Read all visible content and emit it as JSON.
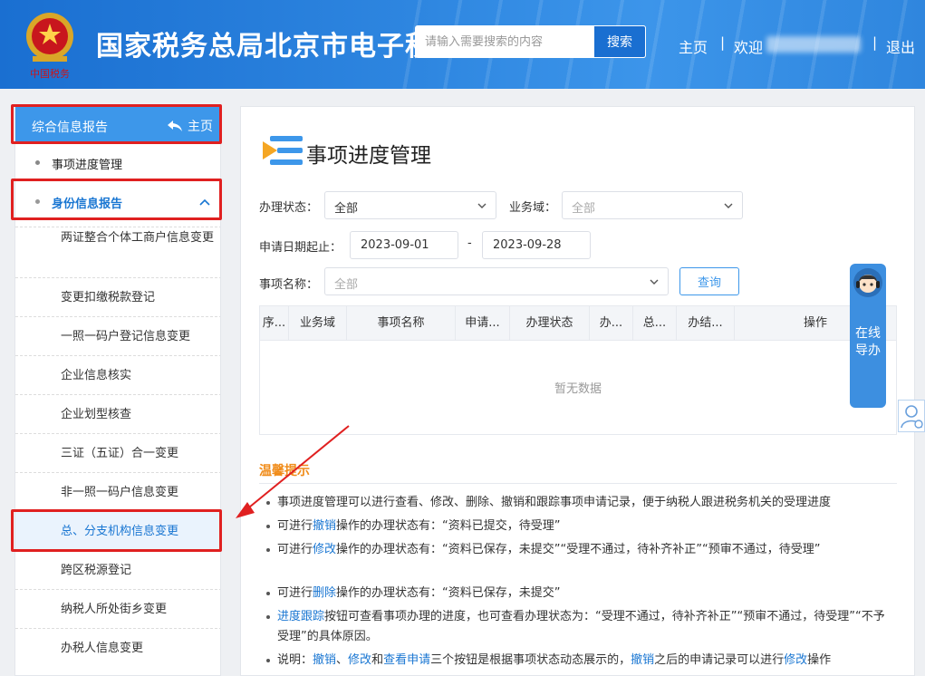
{
  "header": {
    "title": "国家税务总局北京市电子税",
    "emblem_text": "中国税务",
    "search_placeholder": "请输入需要搜索的内容",
    "search_button": "搜索",
    "nav_home": "主页",
    "nav_sep": "|",
    "nav_welcome": "欢迎",
    "nav_exit": "退出"
  },
  "sidebar": {
    "head_title": "综合信息报告",
    "head_home": "主页",
    "item_progress": "事项进度管理",
    "group_label": "身份信息报告",
    "sub_items": [
      "两证整合个体工商户信息变更",
      "变更扣缴税款登记",
      "一照一码户登记信息变更",
      "企业信息核实",
      "企业划型核查",
      "三证（五证）合一变更",
      "非一照一码户信息变更",
      "总、分支机构信息变更",
      "跨区税源登记",
      "纳税人所处街乡变更",
      "办税人信息变更"
    ]
  },
  "main": {
    "page_title": "事项进度管理",
    "filters": {
      "status_label": "办理状态：",
      "status_value": "全部",
      "domain_label": "业务域：",
      "domain_value": "全部",
      "date_label": "申请日期起止：",
      "date_from": "2023-09-01",
      "date_sep": "-",
      "date_to": "2023-09-28",
      "item_label": "事项名称：",
      "item_value": "全部",
      "query_button": "查询"
    },
    "table": {
      "columns": [
        "序...",
        "业务域",
        "事项名称",
        "申请...",
        "办理状态",
        "办...",
        "总...",
        "办结...",
        "操作"
      ],
      "empty_text": "暂无数据"
    },
    "tips": {
      "title": "温馨提示",
      "t1": "事项进度管理可以进行查看、修改、删除、撤销和跟踪事项申请记录，便于纳税人跟进税务机关的受理进度",
      "t2a": "可进行",
      "t2b": "撤销",
      "t2c": "操作的办理状态有：“资料已提交，待受理”",
      "t3a": "可进行",
      "t3b": "修改",
      "t3c": "操作的办理状态有：“资料已保存，未提交”“受理不通过，待补齐补正”“预审不通过，待受理”",
      "t4a": "可进行",
      "t4b": "删除",
      "t4c": "操作的办理状态有：“资料已保存，未提交”",
      "t5a": "进度跟踪",
      "t5b": "按钮可查看事项办理的进度，也可查看办理状态为：“受理不通过，待补齐补正”“预审不通过，待受理”“不予受理”的具体原因。",
      "t6a": "说明：",
      "t6b": "撤销",
      "t6c": "、",
      "t6d": "修改",
      "t6e": "和",
      "t6f": "查看申请",
      "t6g": "三个按钮是根据事项状态动态展示的，",
      "t6h": "撤销",
      "t6i": "之后的申请记录可以进行",
      "t6j": "修改",
      "t6k": "操作"
    }
  },
  "assistant": {
    "label": "在线导办"
  },
  "colors": {
    "primary": "#3d97ea",
    "header": "#1a6fd1",
    "annotation_red": "#e02020",
    "tip_title": "#f08c1a",
    "link": "#1976d2"
  }
}
